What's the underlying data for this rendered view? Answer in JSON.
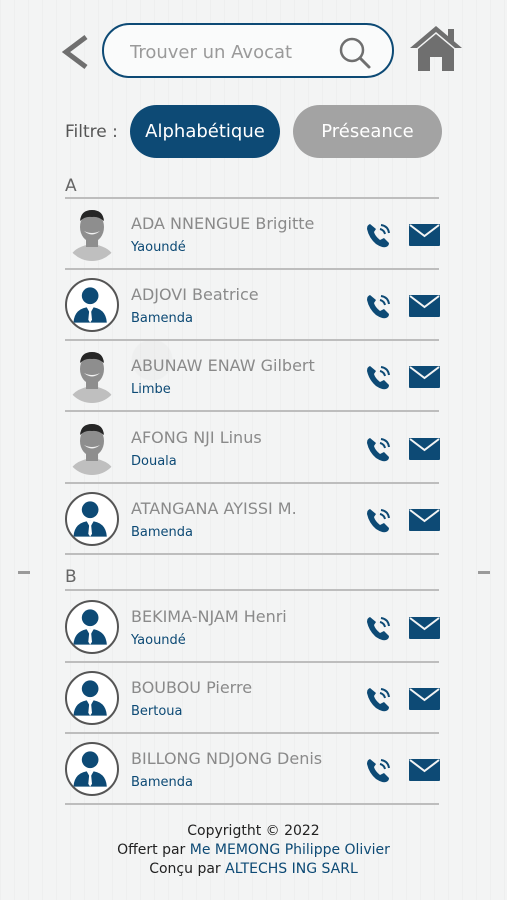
{
  "search": {
    "placeholder": "Trouver un Avocat"
  },
  "filter": {
    "label": "Filtre :",
    "options": [
      "Alphabétique",
      "Préseance"
    ],
    "selected": "Alphabétique"
  },
  "colors": {
    "accent": "#0d4a75",
    "inactive_pill": "#a3a3a3",
    "name_text": "#8a8a8a"
  },
  "icons": {
    "back": "chevron-left-icon",
    "search": "search-icon",
    "home": "home-icon",
    "phone": "phone-icon",
    "mail": "mail-icon",
    "avatar": "user-avatar-icon"
  },
  "sections": [
    {
      "letter": "A",
      "items": [
        {
          "name": "ADA NNENGUE Brigitte",
          "city": "Yaoundé",
          "avatar": "photo"
        },
        {
          "name": "ADJOVI Beatrice",
          "city": "Bamenda",
          "avatar": "generic"
        },
        {
          "name": "ABUNAW ENAW Gilbert",
          "city": "Limbe",
          "avatar": "photo"
        },
        {
          "name": "AFONG NJI Linus",
          "city": "Douala",
          "avatar": "photo"
        },
        {
          "name": "ATANGANA AYISSI M.",
          "city": "Bamenda",
          "avatar": "generic"
        }
      ]
    },
    {
      "letter": "B",
      "items": [
        {
          "name": "BEKIMA-NJAM Henri",
          "city": "Yaoundé",
          "avatar": "generic"
        },
        {
          "name": "BOUBOU Pierre",
          "city": "Bertoua",
          "avatar": "generic"
        },
        {
          "name": "BILLONG NDJONG Denis",
          "city": "Bamenda",
          "avatar": "generic"
        }
      ]
    }
  ],
  "footer": {
    "copyright": "Copyrigtht © 2022",
    "offered_prefix": "Offert par ",
    "offered_by": "Me MEMONG Philippe Olivier",
    "designed_prefix": "Conçu par ",
    "designed_by": "ALTECHS ING SARL"
  }
}
